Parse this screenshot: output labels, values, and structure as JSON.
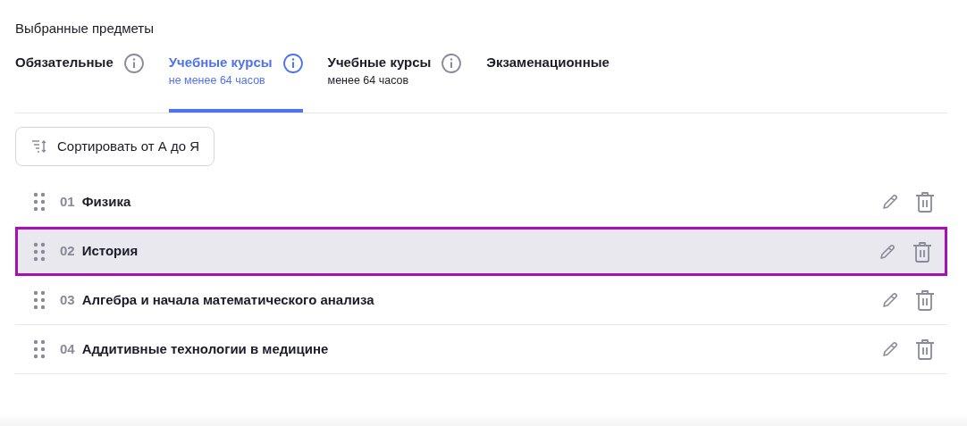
{
  "section_title": "Выбранные предметы",
  "tabs": [
    {
      "label": "Обязательные",
      "info": true,
      "selected": false
    },
    {
      "label": "Учебные курсы",
      "subtitle": "не менее 64 часов",
      "info": true,
      "selected": true
    },
    {
      "label": "Учебные курсы",
      "subtitle": "менее 64 часов",
      "info": true,
      "selected": false
    },
    {
      "label": "Экзаменационные",
      "info": false,
      "selected": false
    }
  ],
  "sort_button": {
    "label": "Сортировать от А до Я"
  },
  "rows": [
    {
      "number": "01",
      "name": "Физика",
      "selected": false
    },
    {
      "number": "02",
      "name": "История",
      "selected": true
    },
    {
      "number": "03",
      "name": "Алгебра и начала математического анализа",
      "selected": false
    },
    {
      "number": "04",
      "name": "Аддитивные технологии в медицине",
      "selected": false
    }
  ]
}
